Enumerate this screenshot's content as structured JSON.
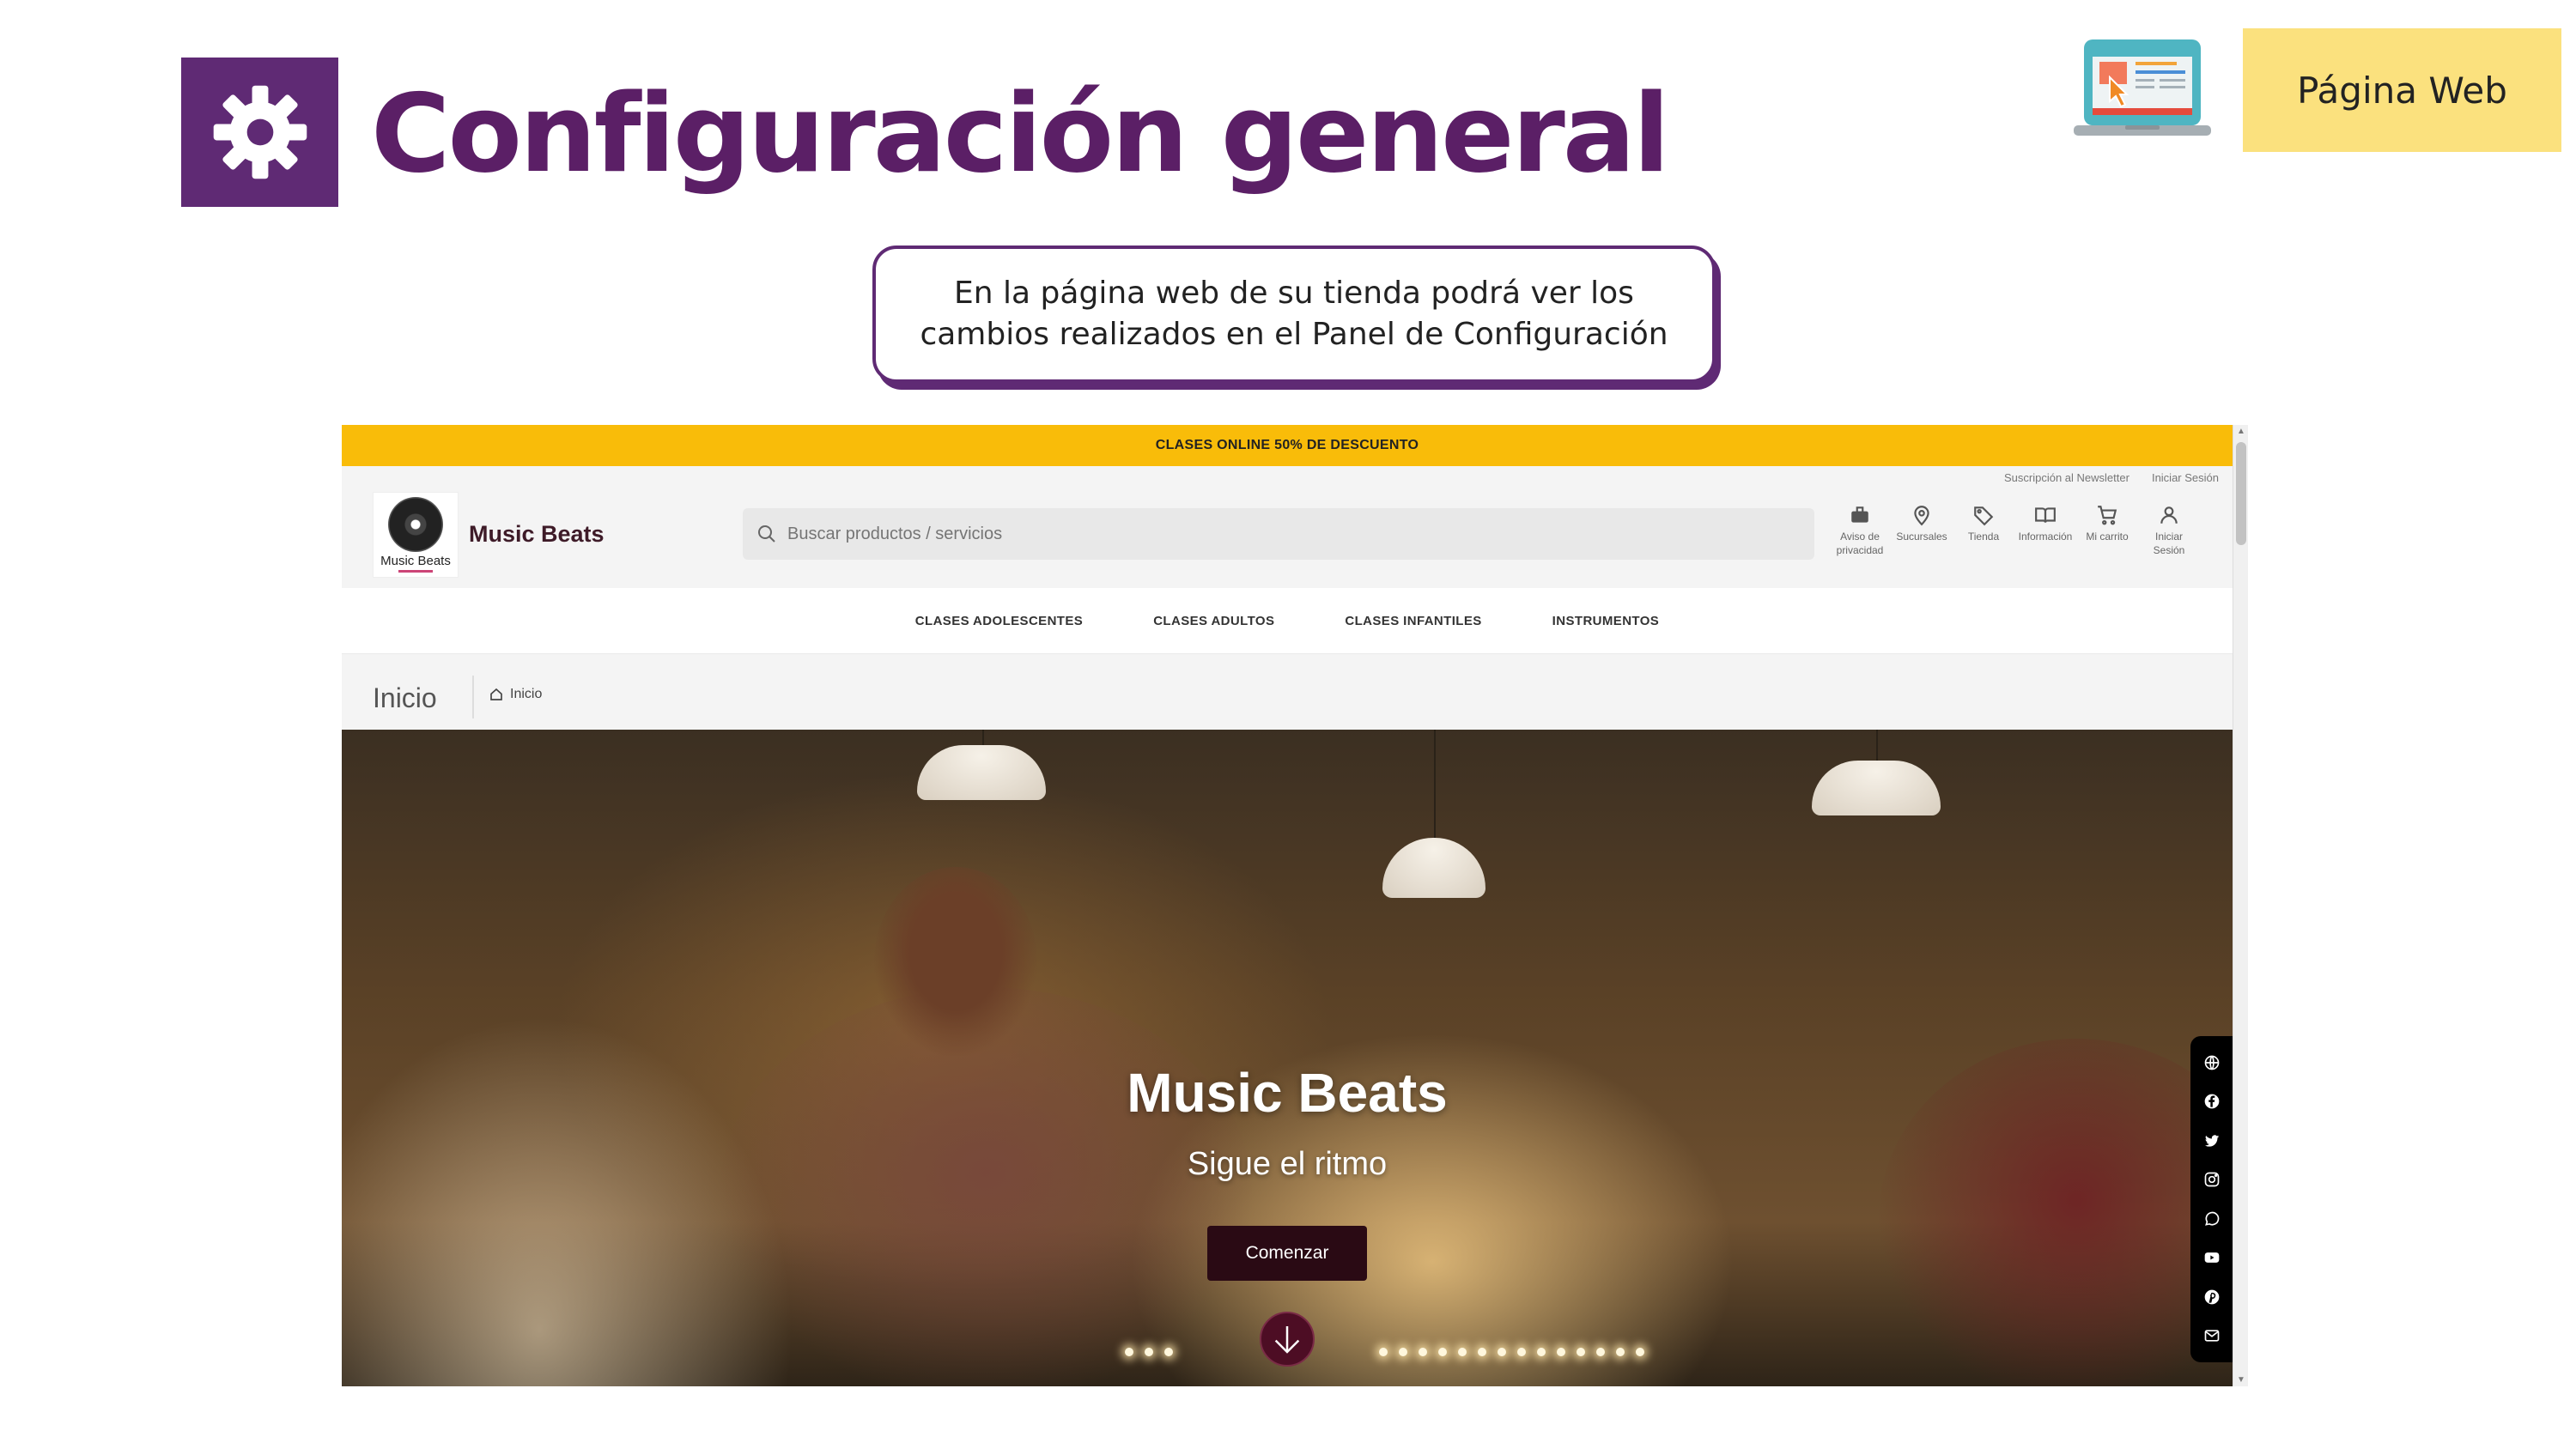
{
  "slide": {
    "title": "Configuración general",
    "badge": "Página Web",
    "callout": "En la página web de su tienda podrá ver los cambios realizados en el Panel de Configuración",
    "colors": {
      "primary": "#5f2a74",
      "badge": "#fbe17e"
    },
    "icons": [
      "gear-icon",
      "laptop-web-icon"
    ]
  },
  "site": {
    "promo": "CLASES ONLINE 50% DE DESCUENTO",
    "toplinks": [
      "Suscripción al Newsletter",
      "Iniciar Sesión"
    ],
    "logo_text": "Music Beats",
    "brand": "Music Beats",
    "search": {
      "placeholder": "Buscar productos / servicios",
      "value": ""
    },
    "nav_icons": [
      {
        "icon": "briefcase-icon",
        "label": "Aviso de privacidad"
      },
      {
        "icon": "map-pin-icon",
        "label": "Sucursales"
      },
      {
        "icon": "tag-icon",
        "label": "Tienda"
      },
      {
        "icon": "book-icon",
        "label": "Información"
      },
      {
        "icon": "cart-icon",
        "label": "Mi carrito"
      },
      {
        "icon": "user-icon",
        "label": "Iniciar Sesión"
      }
    ],
    "menu": [
      "CLASES ADOLESCENTES",
      "CLASES ADULTOS",
      "CLASES INFANTILES",
      "INSTRUMENTOS"
    ],
    "page_title": "Inicio",
    "breadcrumb": "Inicio",
    "hero": {
      "title": "Music Beats",
      "subtitle": "Sigue el ritmo",
      "button": "Comenzar"
    },
    "social": [
      "globe-icon",
      "facebook-icon",
      "twitter-icon",
      "instagram-icon",
      "whatsapp-icon",
      "youtube-icon",
      "pinterest-icon",
      "email-icon"
    ],
    "colors": {
      "promo": "#f9bc09",
      "brand": "#3e1b28",
      "button": "#2a0a14"
    }
  }
}
